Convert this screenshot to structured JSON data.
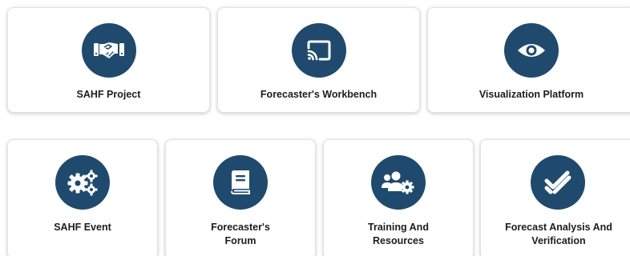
{
  "colors": {
    "icon_background": "#1f4a6e",
    "icon_foreground": "#ffffff",
    "card_background": "#ffffff",
    "label_text": "#1d1d1d"
  },
  "cards": [
    {
      "icon": "handshake-icon",
      "label_lines": [
        "SAHF Project"
      ]
    },
    {
      "icon": "cast-icon",
      "label_lines": [
        "Forecaster's Workbench"
      ]
    },
    {
      "icon": "eye-icon",
      "label_lines": [
        "Visualization Platform"
      ]
    },
    {
      "icon": "gears-icon",
      "label_lines": [
        "SAHF Event"
      ]
    },
    {
      "icon": "book-icon",
      "label_lines": [
        "Forecaster's",
        "Forum"
      ]
    },
    {
      "icon": "users-gear-icon",
      "label_lines": [
        "Training And",
        "Resources"
      ]
    },
    {
      "icon": "double-check-icon",
      "label_lines": [
        "Forecast Analysis And",
        "Verification"
      ]
    }
  ]
}
